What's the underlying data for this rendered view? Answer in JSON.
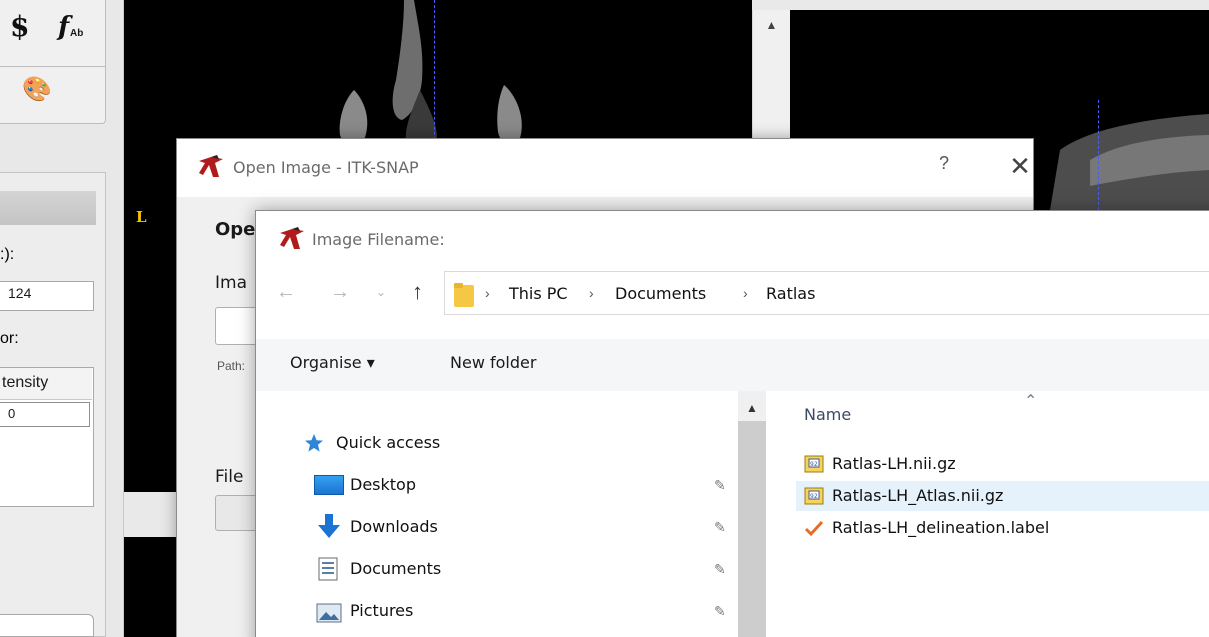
{
  "main_window": {
    "left_panel": {
      "tool_labels": [
        "Ab"
      ],
      "label_coord": ":):",
      "coord_value": "124",
      "label_color": "or:",
      "table_header": "tensity",
      "table_value": "0"
    },
    "view": {
      "orientation_label": "L"
    }
  },
  "open_image_dialog": {
    "title": "Open Image - ITK-SNAP",
    "help_label": "?",
    "close_label": "✕",
    "heading": "Ope",
    "image_label": "Ima",
    "path_label": "Path:",
    "file_label": "File"
  },
  "file_dialog": {
    "title": "Image Filename:",
    "address": {
      "crumbs": [
        "This PC",
        "Documents",
        "Ratlas"
      ]
    },
    "toolbar": {
      "organise_label": "Organise ▾",
      "new_folder_label": "New folder"
    },
    "nav": {
      "quick_access": "Quick access",
      "items": [
        {
          "label": "Desktop",
          "icon": "desktop-icon"
        },
        {
          "label": "Downloads",
          "icon": "downloads-icon"
        },
        {
          "label": "Documents",
          "icon": "documents-icon"
        },
        {
          "label": "Pictures",
          "icon": "pictures-icon"
        }
      ]
    },
    "files": {
      "column_name": "Name",
      "rows": [
        {
          "name": "Ratlas-LH.nii.gz",
          "icon": "image-file-icon",
          "selected": false
        },
        {
          "name": "Ratlas-LH_Atlas.nii.gz",
          "icon": "image-file-icon",
          "selected": true
        },
        {
          "name": "Ratlas-LH_delineation.label",
          "icon": "checkmark-file-icon",
          "selected": false
        }
      ]
    },
    "colors": {
      "selection": "#e5f1fb",
      "folder": "#f6c744",
      "accent_blue": "#1b74d3",
      "checkmark": "#e96b26"
    }
  }
}
